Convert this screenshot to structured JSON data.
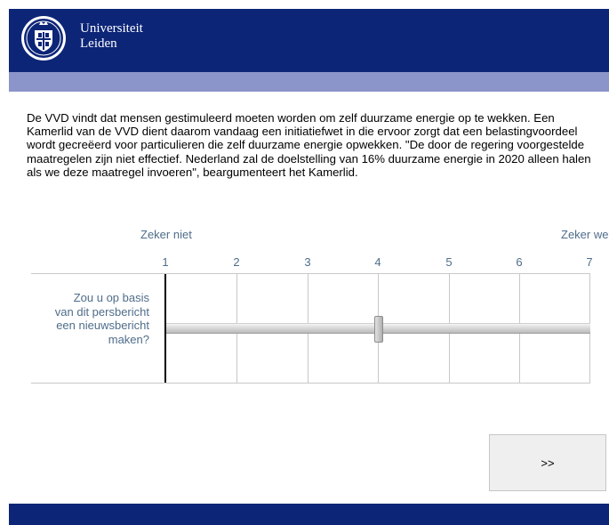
{
  "header": {
    "logo_line1": "Universiteit",
    "logo_line2": "Leiden",
    "colors": {
      "primary": "#0c2577",
      "secondary": "#8b95c9",
      "label": "#4f6d8a"
    }
  },
  "question": {
    "text": "De VVD vindt dat mensen gestimuleerd moeten worden om zelf duurzame energie op te wekken. Een Kamerlid van de VVD dient daarom vandaag een initiatiefwet in die ervoor zorgt dat een belastingvoordeel wordt gecreëerd voor particulieren die zelf duurzame energie opwekken. \"De door de regering voorgestelde maatregelen zijn niet effectief. Nederland zal de doelstelling van 16% duurzame energie in 2020 alleen halen als we deze maatregel invoeren\", beargumenteert het Kamerlid."
  },
  "scale": {
    "left_label": "Zeker niet",
    "right_label": "Zeker wel",
    "numbers": [
      "1",
      "2",
      "3",
      "4",
      "5",
      "6",
      "7"
    ]
  },
  "row": {
    "label": "Zou u op basis van dit persbericht een nieuwsbericht maken?",
    "slider_value": 4
  },
  "navigation": {
    "next_label": ">>"
  }
}
